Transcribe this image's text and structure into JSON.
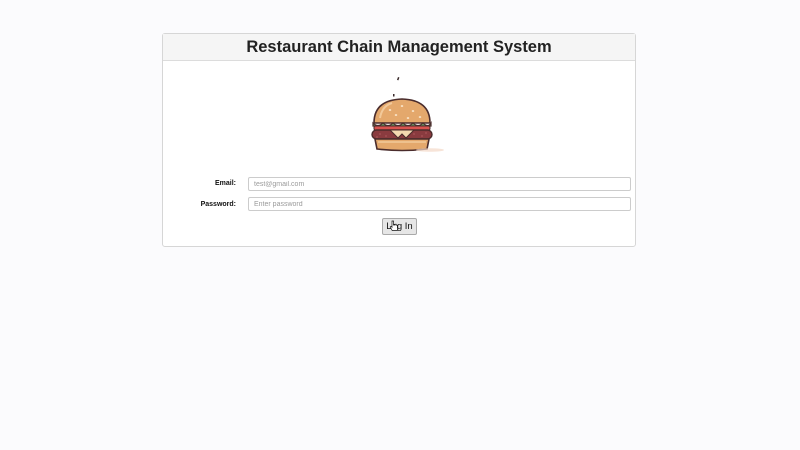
{
  "header": {
    "title": "Restaurant Chain Management System"
  },
  "logo": {
    "icon": "burger-icon"
  },
  "form": {
    "email": {
      "label": "Email:",
      "placeholder": "test@gmail.com",
      "value": ""
    },
    "password": {
      "label": "Password:",
      "placeholder": "Enter password",
      "value": ""
    },
    "submit_label": "Log In"
  },
  "colors": {
    "header_bg": "#f5f5f5",
    "bun": "#e4a86c",
    "patty": "#8a3b3f",
    "cheese": "#f3d9b0",
    "lettuce": "#6fa86a",
    "outline": "#4a2c2c"
  }
}
